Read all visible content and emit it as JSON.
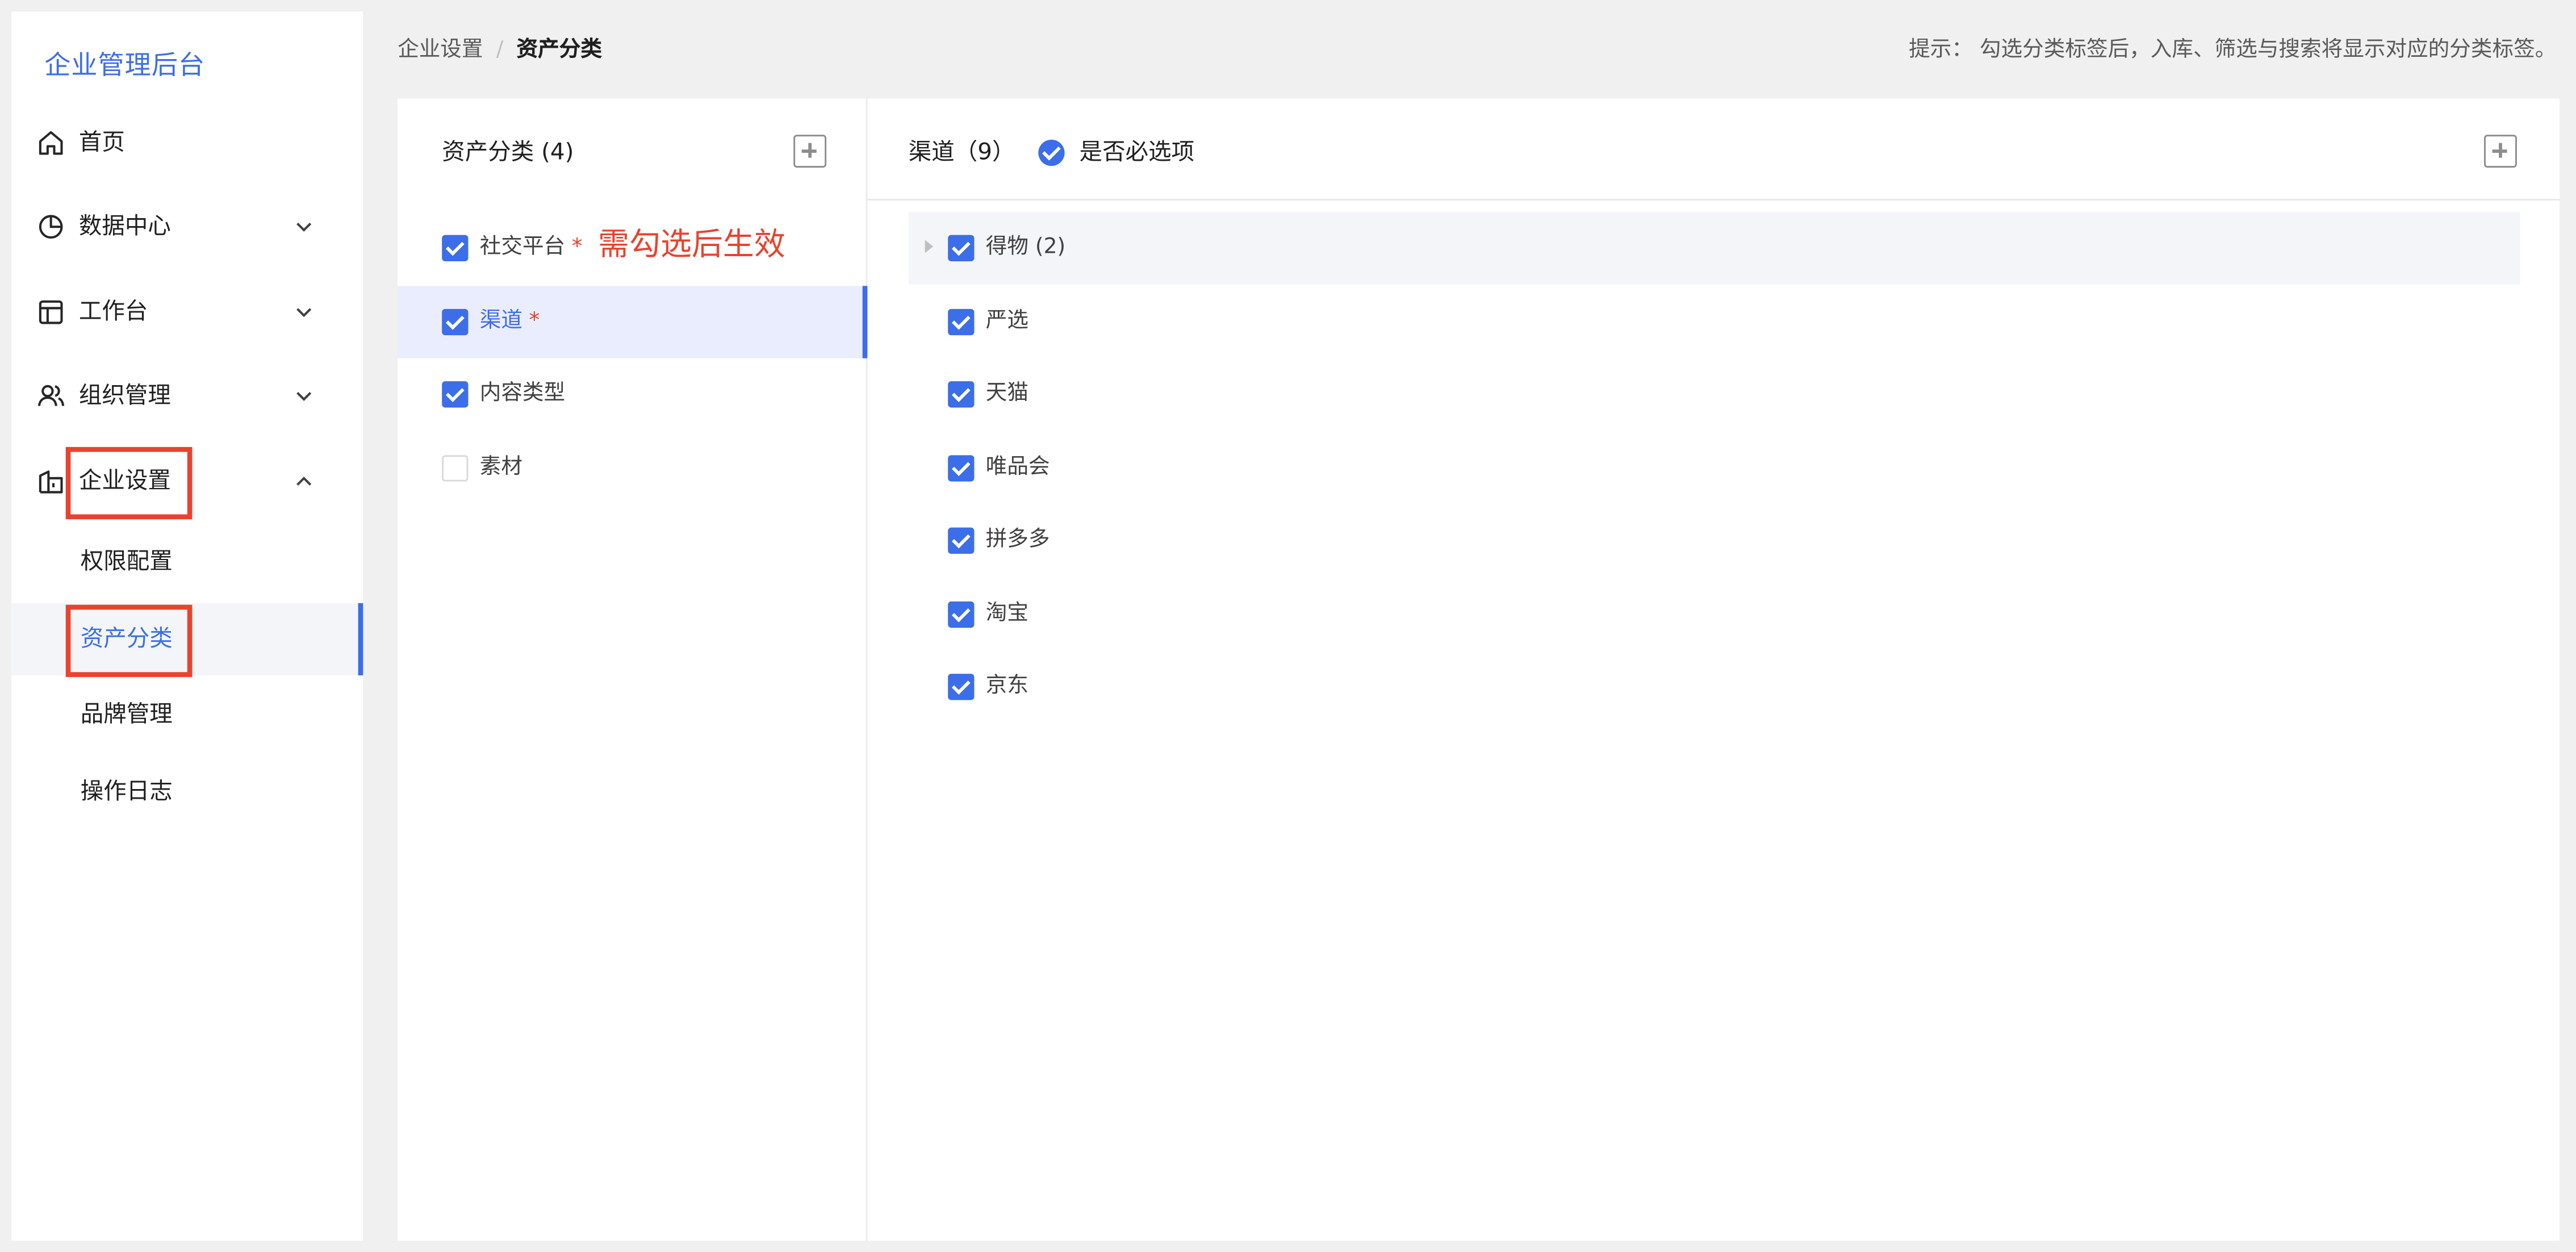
{
  "sidebar": {
    "brand": "企业管理后台",
    "items": [
      {
        "label": "首页",
        "icon": "home-icon"
      },
      {
        "label": "数据中心",
        "icon": "pie-chart-icon"
      },
      {
        "label": "工作台",
        "icon": "layout-icon"
      },
      {
        "label": "组织管理",
        "icon": "users-icon"
      },
      {
        "label": "企业设置",
        "icon": "building-icon",
        "expanded": true
      }
    ],
    "subitems": [
      {
        "label": "权限配置"
      },
      {
        "label": "资产分类",
        "active": true
      },
      {
        "label": "品牌管理"
      },
      {
        "label": "操作日志"
      }
    ]
  },
  "breadcrumb": {
    "parent": "企业设置",
    "separator": "/",
    "current": "资产分类"
  },
  "hint": "提示： 勾选分类标签后，入库、筛选与搜索将显示对应的分类标签。",
  "categories": {
    "title": "资产分类 (4)",
    "items": [
      {
        "label": "社交平台",
        "required_mark": "*",
        "checked": true
      },
      {
        "label": "渠道",
        "required_mark": "*",
        "checked": true,
        "active": true
      },
      {
        "label": "内容类型",
        "checked": true
      },
      {
        "label": "素材",
        "checked": false
      }
    ],
    "annotation": "需勾选后生效"
  },
  "channels": {
    "title": "渠道（9）",
    "required_toggle_label": "是否必选项",
    "required_toggle_on": true,
    "parent": {
      "label": "得物 (2)",
      "checked": true
    },
    "children": [
      {
        "label": "严选",
        "checked": true
      },
      {
        "label": "天猫",
        "checked": true
      },
      {
        "label": "唯品会",
        "checked": true
      },
      {
        "label": "拼多多",
        "checked": true
      },
      {
        "label": "淘宝",
        "checked": true
      },
      {
        "label": "京东",
        "checked": true
      }
    ]
  },
  "colors": {
    "accent": "#3b6ee8",
    "highlight": "#e8432e"
  }
}
